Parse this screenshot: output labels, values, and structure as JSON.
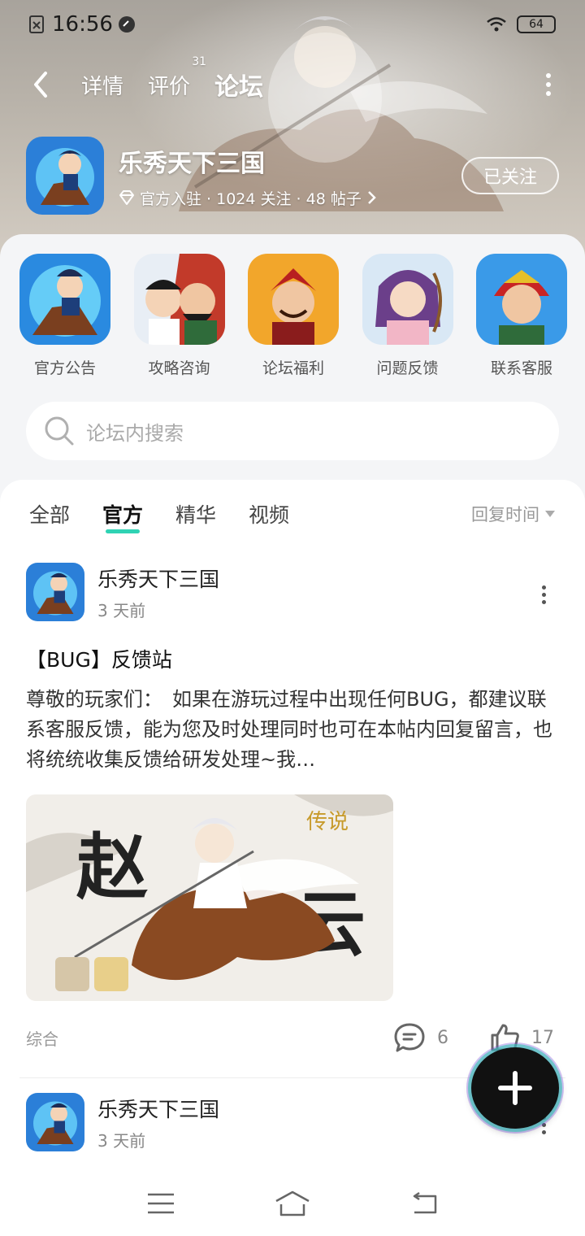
{
  "status_bar": {
    "time": "16:56",
    "battery": "64"
  },
  "nav": {
    "tabs": [
      {
        "label": "详情",
        "badge": ""
      },
      {
        "label": "评价",
        "badge": "31"
      },
      {
        "label": "论坛",
        "badge": ""
      }
    ],
    "active_tab": "论坛"
  },
  "game": {
    "title": "乐秀天下三国",
    "meta": "官方入驻 · 1024 关注 · 48 帖子",
    "follow_label": "已关注"
  },
  "categories": [
    {
      "label": "官方公告",
      "icon": "hero-rider-icon"
    },
    {
      "label": "攻略咨询",
      "icon": "two-heroes-icon"
    },
    {
      "label": "论坛福利",
      "icon": "warlord-icon"
    },
    {
      "label": "问题反馈",
      "icon": "archer-girl-icon"
    },
    {
      "label": "联系客服",
      "icon": "red-general-icon"
    }
  ],
  "search": {
    "placeholder": "论坛内搜索"
  },
  "filter": {
    "tabs": [
      "全部",
      "官方",
      "精华",
      "视频"
    ],
    "active": "官方",
    "sort_label": "回复时间"
  },
  "posts": [
    {
      "author": "乐秀天下三国",
      "time": "3 天前",
      "title": "【BUG】反馈站",
      "body": "尊敬的玩家们：　如果在游玩过程中出现任何BUG，都建议联系客服反馈，能为您及时处理同时也可在本帖内回复留言，也将统统收集反馈给研发处理~我…",
      "image_text": [
        "赵",
        "云",
        "传说"
      ],
      "tag": "综合",
      "comments": "6",
      "likes": "17"
    },
    {
      "author": "乐秀天下三国",
      "time": "3 天前"
    }
  ],
  "colors": {
    "accent": "#2fd3b4",
    "header_bg": "#b9b3aa"
  }
}
